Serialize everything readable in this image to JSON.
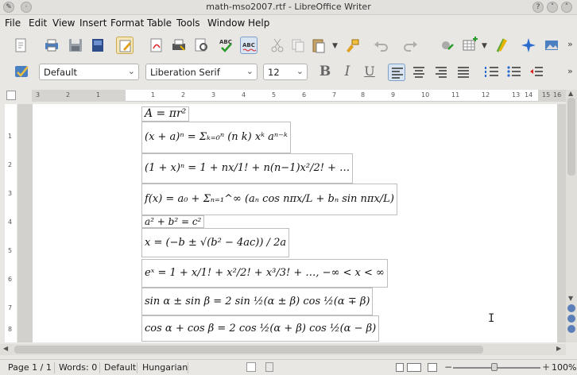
{
  "window": {
    "title": "math-mso2007.rtf - LibreOffice Writer"
  },
  "menu": [
    "File",
    "Edit",
    "View",
    "Insert",
    "Format",
    "Table",
    "Tools",
    "Window",
    "Help"
  ],
  "toolbar2": {
    "paragraph_style": "Default",
    "font_name": "Liberation Serif",
    "font_size": "12"
  },
  "ruler": {
    "h_labels": [
      "3",
      "2",
      "1",
      "1",
      "2",
      "3",
      "4",
      "5",
      "6",
      "7",
      "8",
      "9",
      "10",
      "11",
      "12",
      "13",
      "14",
      "15",
      "16"
    ],
    "v_labels": [
      "1",
      "2",
      "3",
      "4",
      "5",
      "6",
      "7",
      "8"
    ]
  },
  "formulas": [
    "A = πr²",
    "(x + a)ⁿ = Σₖ₌₀ⁿ (n k) xᵏ aⁿ⁻ᵏ",
    "(1 + x)ⁿ = 1 + nx/1! + n(n−1)x²/2! + …",
    "f(x) = a₀ + Σₙ₌₁^∞ (aₙ cos nπx/L + bₙ sin nπx/L)",
    "a² + b² = c²",
    "x = (−b ± √(b² − 4ac)) / 2a",
    "eˣ = 1 + x/1! + x²/2! + x³/3! + …, −∞ < x < ∞",
    "sin α ± sin β = 2 sin ½(α ± β) cos ½(α ∓ β)",
    "cos α + cos β = 2 cos ½(α + β) cos ½(α − β)"
  ],
  "status": {
    "page": "Page 1 / 1",
    "words": "Words: 0",
    "style": "Default",
    "language": "Hungarian",
    "zoom": "100%"
  },
  "colors": {
    "accent": "#3b6ea5",
    "page": "#ffffff",
    "chrome": "#e9e7e3"
  }
}
